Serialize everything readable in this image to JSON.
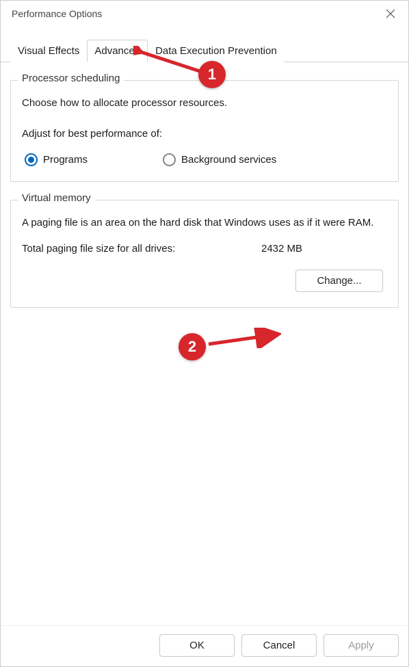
{
  "window": {
    "title": "Performance Options"
  },
  "tabs": {
    "visual_effects": "Visual Effects",
    "advanced": "Advanced",
    "dep": "Data Execution Prevention"
  },
  "processor": {
    "group_title": "Processor scheduling",
    "description": "Choose how to allocate processor resources.",
    "adjust_label": "Adjust for best performance of:",
    "option_programs": "Programs",
    "option_background": "Background services"
  },
  "virtual_memory": {
    "group_title": "Virtual memory",
    "description": "A paging file is an area on the hard disk that Windows uses as if it were RAM.",
    "total_label": "Total paging file size for all drives:",
    "total_value": "2432 MB",
    "change_button": "Change..."
  },
  "footer": {
    "ok": "OK",
    "cancel": "Cancel",
    "apply": "Apply"
  },
  "annotations": {
    "badge1": "1",
    "badge2": "2"
  }
}
